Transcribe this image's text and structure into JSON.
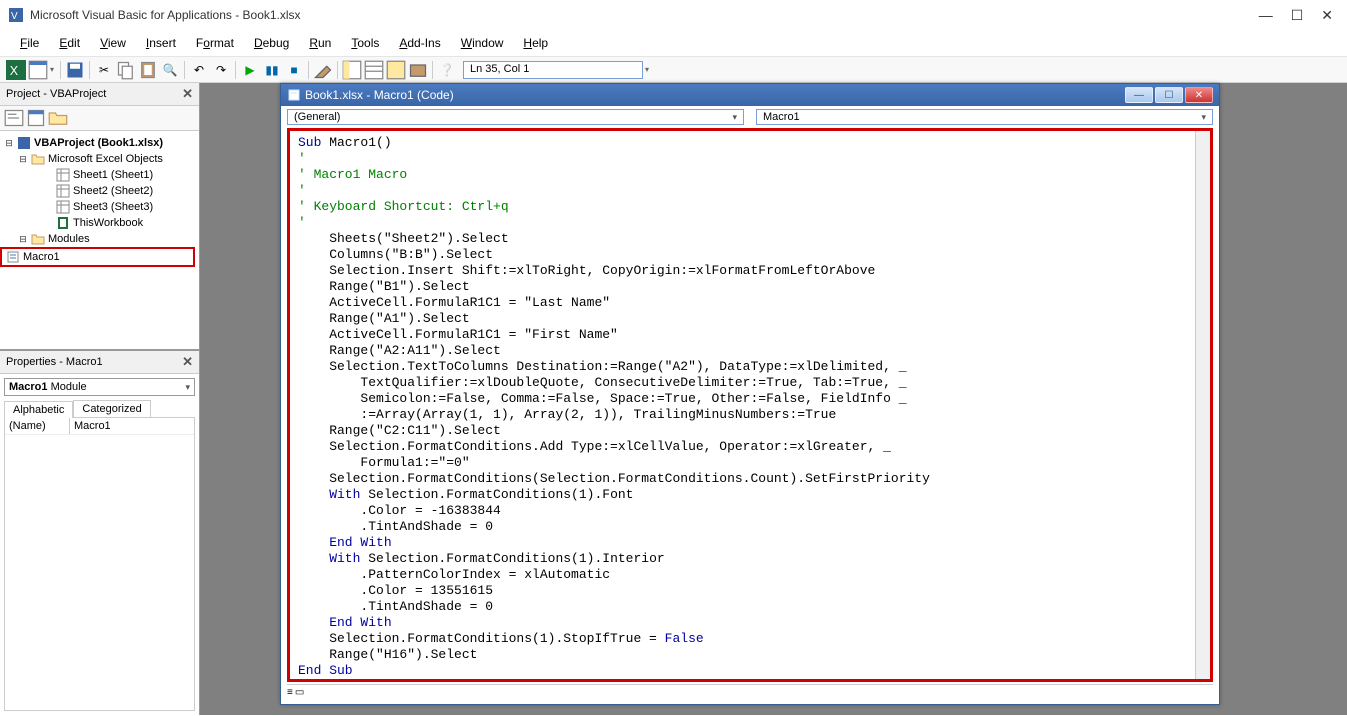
{
  "titlebar": {
    "title": "Microsoft Visual Basic for Applications - Book1.xlsx"
  },
  "win_controls": {
    "min": "—",
    "max": "☐",
    "close": "✕"
  },
  "menubar": {
    "items": [
      {
        "label": "File",
        "u": "F"
      },
      {
        "label": "Edit",
        "u": "E"
      },
      {
        "label": "View",
        "u": "V"
      },
      {
        "label": "Insert",
        "u": "I"
      },
      {
        "label": "Format",
        "u": "o"
      },
      {
        "label": "Debug",
        "u": "D"
      },
      {
        "label": "Run",
        "u": "R"
      },
      {
        "label": "Tools",
        "u": "T"
      },
      {
        "label": "Add-Ins",
        "u": "A"
      },
      {
        "label": "Window",
        "u": "W"
      },
      {
        "label": "Help",
        "u": "H"
      }
    ]
  },
  "toolbar": {
    "cursor_pos": "Ln 35, Col 1"
  },
  "project_panel": {
    "title": "Project - VBAProject",
    "tree": {
      "root": "VBAProject (Book1.xlsx)",
      "objects_label": "Microsoft Excel Objects",
      "sheets": [
        "Sheet1 (Sheet1)",
        "Sheet2 (Sheet2)",
        "Sheet3 (Sheet3)"
      ],
      "workbook": "ThisWorkbook",
      "modules_label": "Modules",
      "module1": "Macro1"
    }
  },
  "props_panel": {
    "title": "Properties - Macro1",
    "object": "Macro1",
    "object_type": "Module",
    "tabs": {
      "alpha": "Alphabetic",
      "cat": "Categorized"
    },
    "rows": [
      {
        "name": "(Name)",
        "value": "Macro1"
      }
    ]
  },
  "code_window": {
    "title": "Book1.xlsx - Macro1 (Code)",
    "dd_left": "(General)",
    "dd_right": "Macro1"
  },
  "code": {
    "lines": [
      {
        "t": "kw",
        "s": "Sub"
      },
      {
        "t": "",
        "s": " Macro1()\n"
      },
      {
        "t": "cm",
        "s": "'\n"
      },
      {
        "t": "cm",
        "s": "' Macro1 Macro\n"
      },
      {
        "t": "cm",
        "s": "'\n"
      },
      {
        "t": "cm",
        "s": "' Keyboard Shortcut: Ctrl+q\n"
      },
      {
        "t": "cm",
        "s": "'\n"
      },
      {
        "t": "",
        "s": "    Sheets(\"Sheet2\").Select\n"
      },
      {
        "t": "",
        "s": "    Columns(\"B:B\").Select\n"
      },
      {
        "t": "",
        "s": "    Selection.Insert Shift:=xlToRight, CopyOrigin:=xlFormatFromLeftOrAbove\n"
      },
      {
        "t": "",
        "s": "    Range(\"B1\").Select\n"
      },
      {
        "t": "",
        "s": "    ActiveCell.FormulaR1C1 = \"Last Name\"\n"
      },
      {
        "t": "",
        "s": "    Range(\"A1\").Select\n"
      },
      {
        "t": "",
        "s": "    ActiveCell.FormulaR1C1 = \"First Name\"\n"
      },
      {
        "t": "",
        "s": "    Range(\"A2:A11\").Select\n"
      },
      {
        "t": "",
        "s": "    Selection.TextToColumns Destination:=Range(\"A2\"), DataType:=xlDelimited, _\n"
      },
      {
        "t": "",
        "s": "        TextQualifier:=xlDoubleQuote, ConsecutiveDelimiter:=True, Tab:=True, _\n"
      },
      {
        "t": "",
        "s": "        Semicolon:=False, Comma:=False, Space:=True, Other:=False, FieldInfo _\n"
      },
      {
        "t": "",
        "s": "        :=Array(Array(1, 1), Array(2, 1)), TrailingMinusNumbers:=True\n"
      },
      {
        "t": "",
        "s": "    Range(\"C2:C11\").Select\n"
      },
      {
        "t": "",
        "s": "    Selection.FormatConditions.Add Type:=xlCellValue, Operator:=xlGreater, _\n"
      },
      {
        "t": "",
        "s": "        Formula1:=\"=0\"\n"
      },
      {
        "t": "",
        "s": "    Selection.FormatConditions(Selection.FormatConditions.Count).SetFirstPriority\n"
      },
      {
        "t": "kw",
        "s": "    With"
      },
      {
        "t": "",
        "s": " Selection.FormatConditions(1).Font\n"
      },
      {
        "t": "",
        "s": "        .Color = -16383844\n"
      },
      {
        "t": "",
        "s": "        .TintAndShade = 0\n"
      },
      {
        "t": "kw",
        "s": "    End With\n"
      },
      {
        "t": "kw",
        "s": "    With"
      },
      {
        "t": "",
        "s": " Selection.FormatConditions(1).Interior\n"
      },
      {
        "t": "",
        "s": "        .PatternColorIndex = xlAutomatic\n"
      },
      {
        "t": "",
        "s": "        .Color = 13551615\n"
      },
      {
        "t": "",
        "s": "        .TintAndShade = 0\n"
      },
      {
        "t": "kw",
        "s": "    End With\n"
      },
      {
        "t": "",
        "s": "    Selection.FormatConditions(1).StopIfTrue = "
      },
      {
        "t": "kw",
        "s": "False\n"
      },
      {
        "t": "",
        "s": "    Range(\"H16\").Select\n"
      },
      {
        "t": "kw",
        "s": "End Sub"
      }
    ]
  }
}
